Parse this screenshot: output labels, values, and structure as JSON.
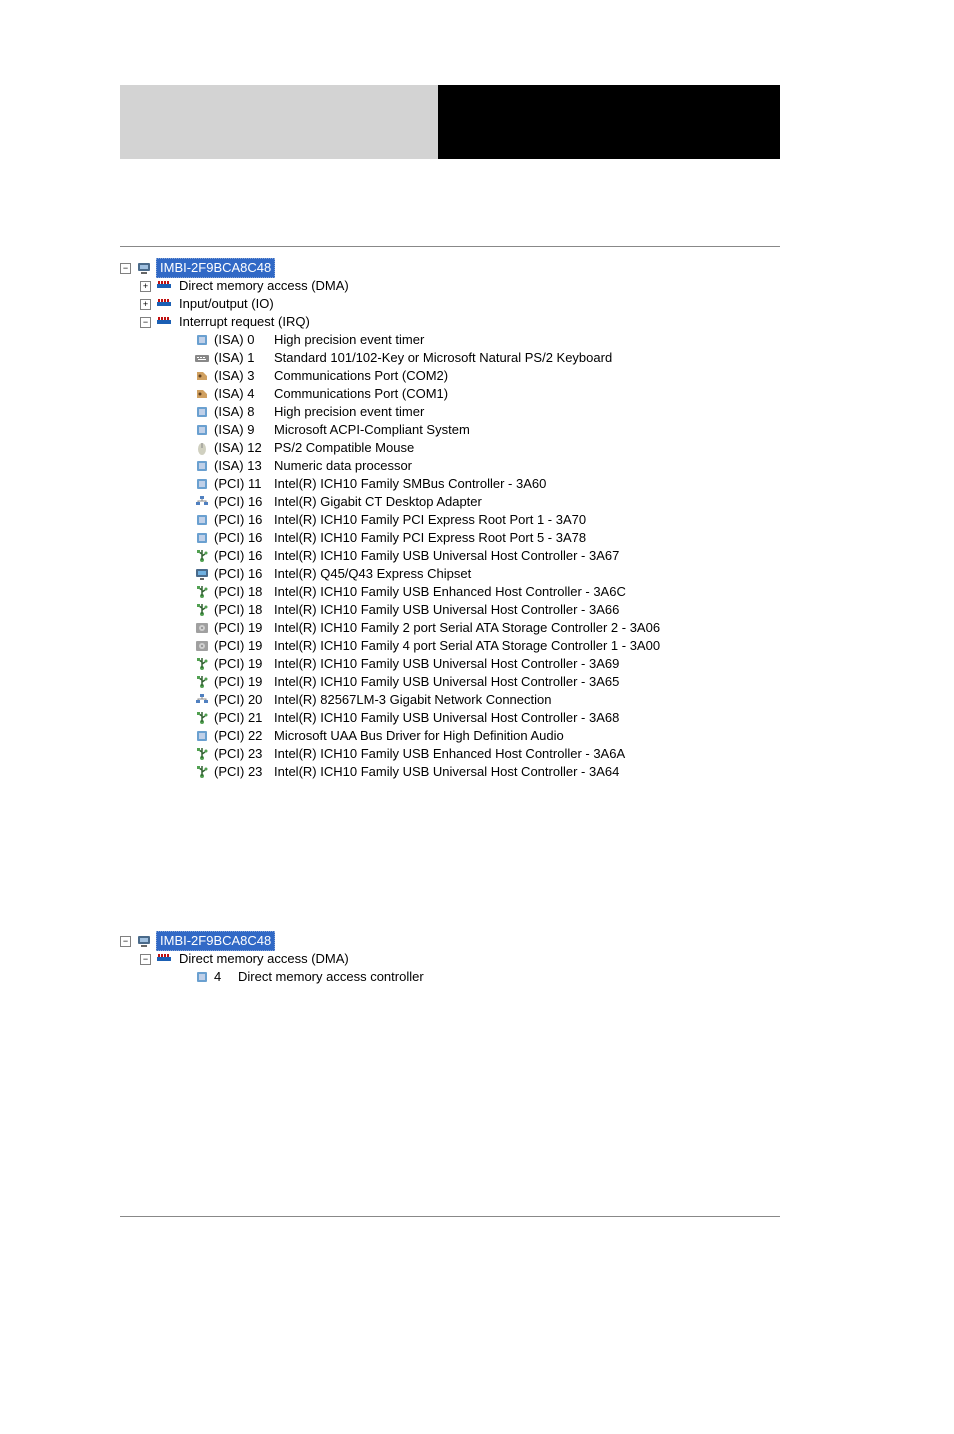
{
  "root_name": "IMBI-2F9BCA8C48",
  "categories": [
    {
      "expanded": false,
      "label": "Direct memory access (DMA)"
    },
    {
      "expanded": false,
      "label": "Input/output (IO)"
    },
    {
      "expanded": true,
      "label": "Interrupt request (IRQ)"
    }
  ],
  "irq_items": [
    {
      "icon": "chip",
      "slot": "(ISA) 0",
      "desc": "High precision event timer"
    },
    {
      "icon": "keyboard",
      "slot": "(ISA) 1",
      "desc": "Standard 101/102-Key or Microsoft Natural PS/2 Keyboard"
    },
    {
      "icon": "port",
      "slot": "(ISA) 3",
      "desc": "Communications Port (COM2)"
    },
    {
      "icon": "port",
      "slot": "(ISA) 4",
      "desc": "Communications Port (COM1)"
    },
    {
      "icon": "chip",
      "slot": "(ISA) 8",
      "desc": "High precision event timer"
    },
    {
      "icon": "chip",
      "slot": "(ISA) 9",
      "desc": "Microsoft ACPI-Compliant System"
    },
    {
      "icon": "mouse",
      "slot": "(ISA) 12",
      "desc": "PS/2 Compatible Mouse"
    },
    {
      "icon": "chip",
      "slot": "(ISA) 13",
      "desc": "Numeric data processor"
    },
    {
      "icon": "chip",
      "slot": "(PCI) 11",
      "desc": "Intel(R) ICH10 Family SMBus Controller - 3A60"
    },
    {
      "icon": "net",
      "slot": "(PCI) 16",
      "desc": "Intel(R) Gigabit CT Desktop Adapter"
    },
    {
      "icon": "chip",
      "slot": "(PCI) 16",
      "desc": "Intel(R) ICH10 Family PCI Express Root Port 1 - 3A70"
    },
    {
      "icon": "chip",
      "slot": "(PCI) 16",
      "desc": "Intel(R) ICH10 Family PCI Express Root Port 5 - 3A78"
    },
    {
      "icon": "usb",
      "slot": "(PCI) 16",
      "desc": "Intel(R) ICH10 Family USB Universal Host Controller - 3A67"
    },
    {
      "icon": "display",
      "slot": "(PCI) 16",
      "desc": "Intel(R) Q45/Q43 Express Chipset"
    },
    {
      "icon": "usb",
      "slot": "(PCI) 18",
      "desc": "Intel(R) ICH10 Family USB Enhanced Host Controller - 3A6C"
    },
    {
      "icon": "usb",
      "slot": "(PCI) 18",
      "desc": "Intel(R) ICH10 Family USB Universal Host Controller - 3A66"
    },
    {
      "icon": "disk",
      "slot": "(PCI) 19",
      "desc": "Intel(R) ICH10 Family 2 port Serial ATA Storage Controller 2 - 3A06"
    },
    {
      "icon": "disk",
      "slot": "(PCI) 19",
      "desc": "Intel(R) ICH10 Family 4 port Serial ATA Storage Controller 1 - 3A00"
    },
    {
      "icon": "usb",
      "slot": "(PCI) 19",
      "desc": "Intel(R) ICH10 Family USB Universal Host Controller - 3A69"
    },
    {
      "icon": "usb",
      "slot": "(PCI) 19",
      "desc": "Intel(R) ICH10 Family USB Universal Host Controller - 3A65"
    },
    {
      "icon": "net",
      "slot": "(PCI) 20",
      "desc": "Intel(R) 82567LM-3 Gigabit Network Connection"
    },
    {
      "icon": "usb",
      "slot": "(PCI) 21",
      "desc": "Intel(R) ICH10 Family USB Universal Host Controller - 3A68"
    },
    {
      "icon": "chip",
      "slot": "(PCI) 22",
      "desc": "Microsoft UAA Bus Driver for High Definition Audio"
    },
    {
      "icon": "usb",
      "slot": "(PCI) 23",
      "desc": "Intel(R) ICH10 Family USB Enhanced Host Controller - 3A6A"
    },
    {
      "icon": "usb",
      "slot": "(PCI) 23",
      "desc": "Intel(R) ICH10 Family USB Universal Host Controller - 3A64"
    }
  ],
  "tree2": {
    "root_name": "IMBI-2F9BCA8C48",
    "category": {
      "label": "Direct memory access (DMA)"
    },
    "item": {
      "slot": "4",
      "desc": "Direct memory access controller"
    }
  },
  "icon_glyphs": {
    "chip": "💠",
    "keyboard": "⌨",
    "port": "📞",
    "mouse": "🖱",
    "net": "🖧",
    "usb": "🔌",
    "display": "🖥",
    "disk": "💾"
  }
}
